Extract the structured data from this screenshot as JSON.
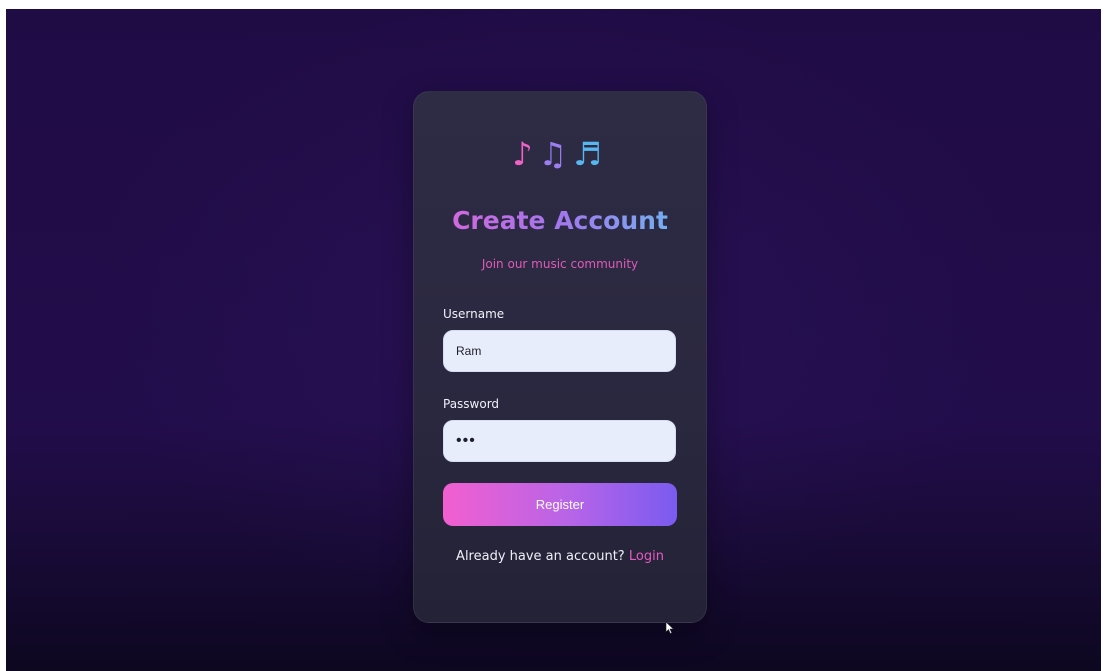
{
  "app": {
    "icons": [
      "music-note-icon",
      "beamed-notes-icon",
      "beamed-sixteenth-notes-icon"
    ],
    "note_glyphs": [
      "♪",
      "♫",
      "♬"
    ]
  },
  "form": {
    "title": "Create Account",
    "subtitle": "Join our music community",
    "username_label": "Username",
    "username_value": "Ram",
    "password_label": "Password",
    "password_value": "•••",
    "register_label": "Register",
    "login_prompt": "Already have an account?",
    "login_link": "Login"
  },
  "colors": {
    "background": "#220d4b",
    "card": "#2c2a42",
    "accent_pink": "#f25fd0",
    "accent_purple": "#7a5bf0",
    "accent_blue": "#56b8ef",
    "link": "#e55ac4"
  }
}
